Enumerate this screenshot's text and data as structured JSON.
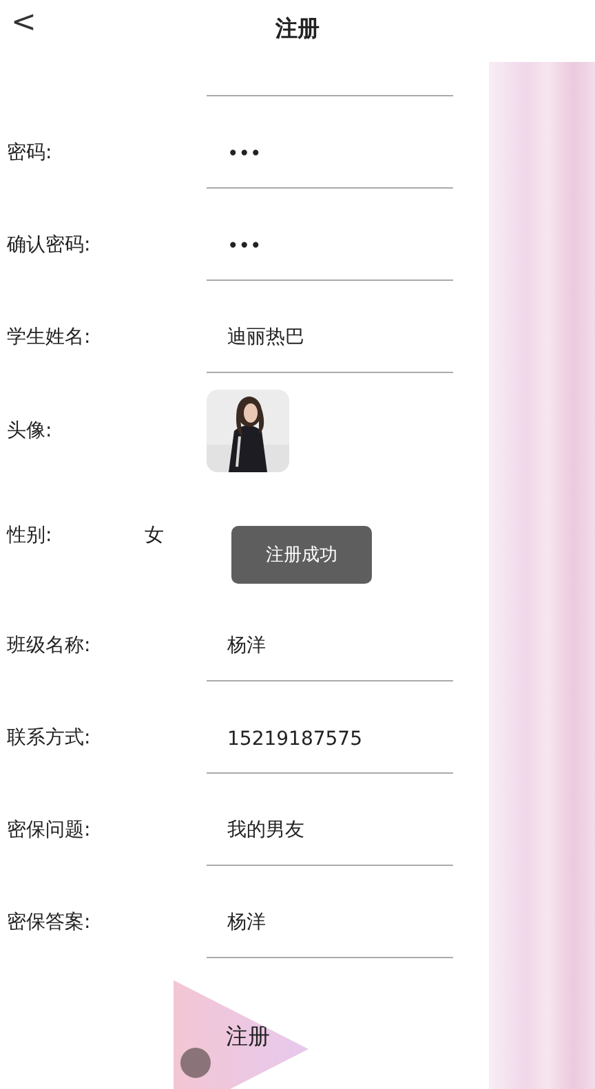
{
  "header": {
    "back": "<",
    "title": "注册"
  },
  "fields": [
    {
      "kind": "input",
      "label": "密码:",
      "value": "•••"
    },
    {
      "kind": "input",
      "label": "确认密码:",
      "value": "•••"
    },
    {
      "kind": "input",
      "label": "学生姓名:",
      "value": "迪丽热巴"
    },
    {
      "kind": "avatar",
      "label": "头像:"
    },
    {
      "kind": "text",
      "label": "性别:",
      "value": "女"
    },
    {
      "kind": "input",
      "label": "班级名称:",
      "value": "杨洋"
    },
    {
      "kind": "input",
      "label": "联系方式:",
      "value": "15219187575"
    },
    {
      "kind": "input",
      "label": "密保问题:",
      "value": "我的男友"
    },
    {
      "kind": "input",
      "label": "密保答案:",
      "value": "杨洋"
    }
  ],
  "toast": "注册成功",
  "submit": "注册"
}
